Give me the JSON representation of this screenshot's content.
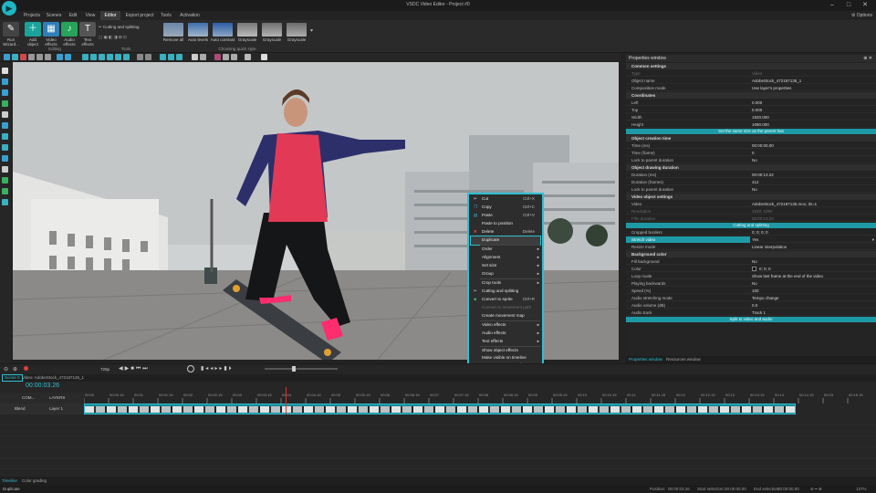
{
  "window": {
    "title": "VSDC Video Editor - Project #0",
    "minimize": "–",
    "maximize": "□",
    "close": "✕"
  },
  "menu": {
    "tabs": [
      "Projects",
      "Scenes",
      "Edit",
      "View",
      "Editor",
      "Export project",
      "Tools",
      "Activation"
    ],
    "active": 4,
    "options": "Options"
  },
  "ribbon": {
    "run_wizard": "Run Wizard...",
    "add_object": "Add object",
    "video_effects": "Video effects",
    "audio_effects": "Audio effects",
    "text_effects": "Text effects",
    "editing_group": "Editing",
    "cutting_splitting": "Cutting and splitting",
    "tools_group": "Tools",
    "quick_styles": [
      "Remove all",
      "Auto levels",
      "Auto contrast",
      "Grayscale",
      "Grayscale",
      "Grayscale"
    ],
    "quick_style_group": "Choosing quick style"
  },
  "properties": {
    "title": "Properties window",
    "common_header": "Common settings",
    "type": {
      "k": "Type",
      "v": "Video"
    },
    "object_name": {
      "k": "Object name",
      "v": "AdobeStock_472187135_1"
    },
    "composition": {
      "k": "Composition mode",
      "v": "Use layer's properties"
    },
    "coords_header": "Coordinates",
    "left": {
      "k": "Left",
      "v": "0.000"
    },
    "top": {
      "k": "Top",
      "v": "0.000"
    },
    "width": {
      "k": "Width",
      "v": "1920.000"
    },
    "height": {
      "k": "Height",
      "v": "1080.000"
    },
    "same_size_btn": "Set the same size as the parent has",
    "creation_header": "Object creation time",
    "time_ms": {
      "k": "Time (ms)",
      "v": "00:00:00.00"
    },
    "time_frame": {
      "k": "Time (frame)",
      "v": "0"
    },
    "lock_parent": {
      "k": "Lock to parent duration",
      "v": "No"
    },
    "drawing_header": "Object drawing duration",
    "duration_ms": {
      "k": "Duration (ms)",
      "v": "00:00:13.22"
    },
    "duration_frames": {
      "k": "Duration (frames)",
      "v": "412"
    },
    "lock_parent2": {
      "k": "Lock to parent duration",
      "v": "No"
    },
    "video_header": "Video object settings",
    "video": {
      "k": "Video",
      "v": "AdobeStock_472187135.mov; ID=1"
    },
    "resolution": {
      "k": "Resolution",
      "v": "1920; 1080"
    },
    "film_duration": {
      "k": "Film duration",
      "v": "00:00:13.22"
    },
    "cut_split_btn": "Cutting and splitting",
    "cropped": {
      "k": "Cropped borders",
      "v": "0; 0; 0; 0"
    },
    "stretch": {
      "k": "Stretch video",
      "v": "Yes"
    },
    "resize": {
      "k": "Resize mode",
      "v": "Linear interpolation"
    },
    "bg_header": "Background color",
    "fill_bg": {
      "k": "Fill background",
      "v": "No"
    },
    "color": {
      "k": "Color",
      "v": "0; 0; 0"
    },
    "loop": {
      "k": "Loop mode",
      "v": "Show last frame at the end of the video"
    },
    "backwards": {
      "k": "Playing backwards",
      "v": "No"
    },
    "speed": {
      "k": "Speed (%)",
      "v": "100"
    },
    "audio_stretch": {
      "k": "Audio stretching mode",
      "v": "Tempo change"
    },
    "audio_volume": {
      "k": "Audio volume (dB)",
      "v": "0.0"
    },
    "audio_track": {
      "k": "Audio track",
      "v": "Track 1"
    },
    "split_btn": "Split to video and audio",
    "tab_props": "Properties window",
    "tab_res": "Resources window"
  },
  "context_menu": {
    "cut": "Cut",
    "cut_sc": "Ctrl+X",
    "copy": "Copy",
    "copy_sc": "Ctrl+C",
    "paste": "Paste",
    "paste_sc": "Ctrl+V",
    "paste_pos": "Paste to position",
    "delete": "Delete",
    "delete_sc": "Delete",
    "duplicate": "Duplicate",
    "order": "Order",
    "alignment": "Alignment",
    "set_size": "Set size",
    "group": "Group",
    "crop_tools": "Crop tools",
    "cutting": "Cutting and splitting",
    "convert": "Convert to sprite",
    "convert_sc": "Ctrl+R",
    "convert_movement": "Convert to movement path",
    "create_map": "Create movement map",
    "video_effects": "Video effects",
    "audio_effects": "Audio effects",
    "text_effects": "Text effects",
    "show_effects": "Show object effects",
    "make_visible": "Make visible on timeline",
    "properties": "Properties...",
    "properties_sc": "Alt+Enter",
    "preview": "Preview objects"
  },
  "controls": {
    "zoom": "720p",
    "position_label": "Editing"
  },
  "timeline": {
    "scene_tab": "Scene 0",
    "video_tab": "Video: AdobeStock_472187135_1",
    "timecode": "00:00:03.26",
    "com_label": "COM...",
    "layers_label": "LAYERS",
    "blend": "Blend",
    "layer": "Layer 1",
    "ruler": [
      "00:00",
      "00:00.15",
      "00:01",
      "00:01.15",
      "00:02",
      "00:02.15",
      "00:03",
      "00:03.15",
      "00:04",
      "00:04.15",
      "00:05",
      "00:05.15",
      "00:06",
      "00:06.15",
      "00:07",
      "00:07.15",
      "00:08",
      "00:08.15",
      "00:09",
      "00:09.15",
      "00:10",
      "00:10.15",
      "00:11",
      "00:11.15",
      "00:12",
      "00:12.15",
      "00:13",
      "00:13.15",
      "00:14",
      "00:14.15",
      "00:15",
      "00:15.15"
    ]
  },
  "bottom_tabs": {
    "timeline": "Timeline",
    "color": "Color grading"
  },
  "status": {
    "left": "Duplicate",
    "position": "Position:",
    "position_v": "00:00:03.26",
    "start": "Start selection:",
    "start_v": "00:00:00.00",
    "end": "End selection:",
    "end_v": "00:00:00.00",
    "zoom": "137%"
  }
}
